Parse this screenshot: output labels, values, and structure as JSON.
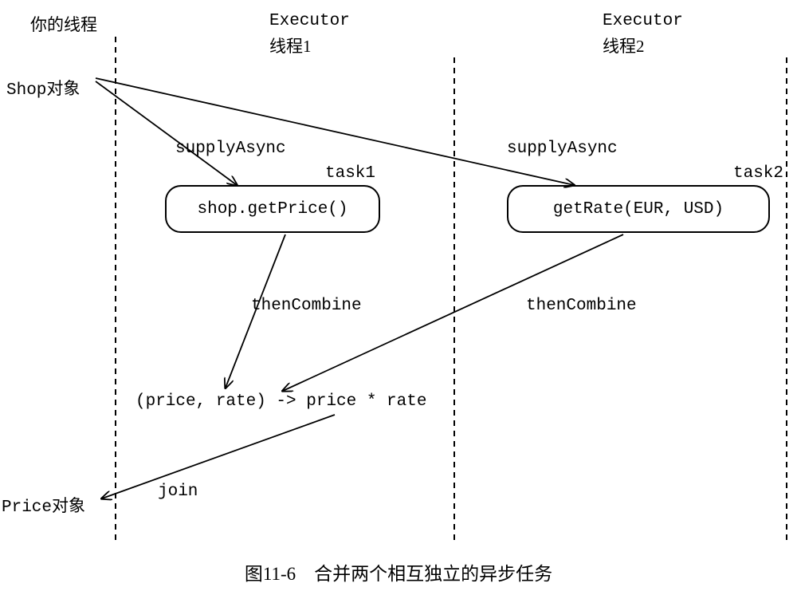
{
  "header": {
    "yourThread": "你的线程",
    "executor1_line1": "Executor",
    "executor1_line2": "线程1",
    "executor2_line1": "Executor",
    "executor2_line2": "线程2"
  },
  "shopObject_prefix": "Shop",
  "shopObject_suffix": "对象",
  "priceObject_prefix": "Price",
  "priceObject_suffix": "对象",
  "arrows": {
    "supplyAsync1": "supplyAsync",
    "supplyAsync2": "supplyAsync",
    "thenCombine1": "thenCombine",
    "thenCombine2": "thenCombine",
    "join": "join"
  },
  "tasks": {
    "task1Label": "task1",
    "task2Label": "task2",
    "task1Box": "shop.getPrice()",
    "task2Box": "getRate(EUR, USD)"
  },
  "lambda": "(price, rate) -> price * rate",
  "caption": "图11-6　合并两个相互独立的异步任务"
}
